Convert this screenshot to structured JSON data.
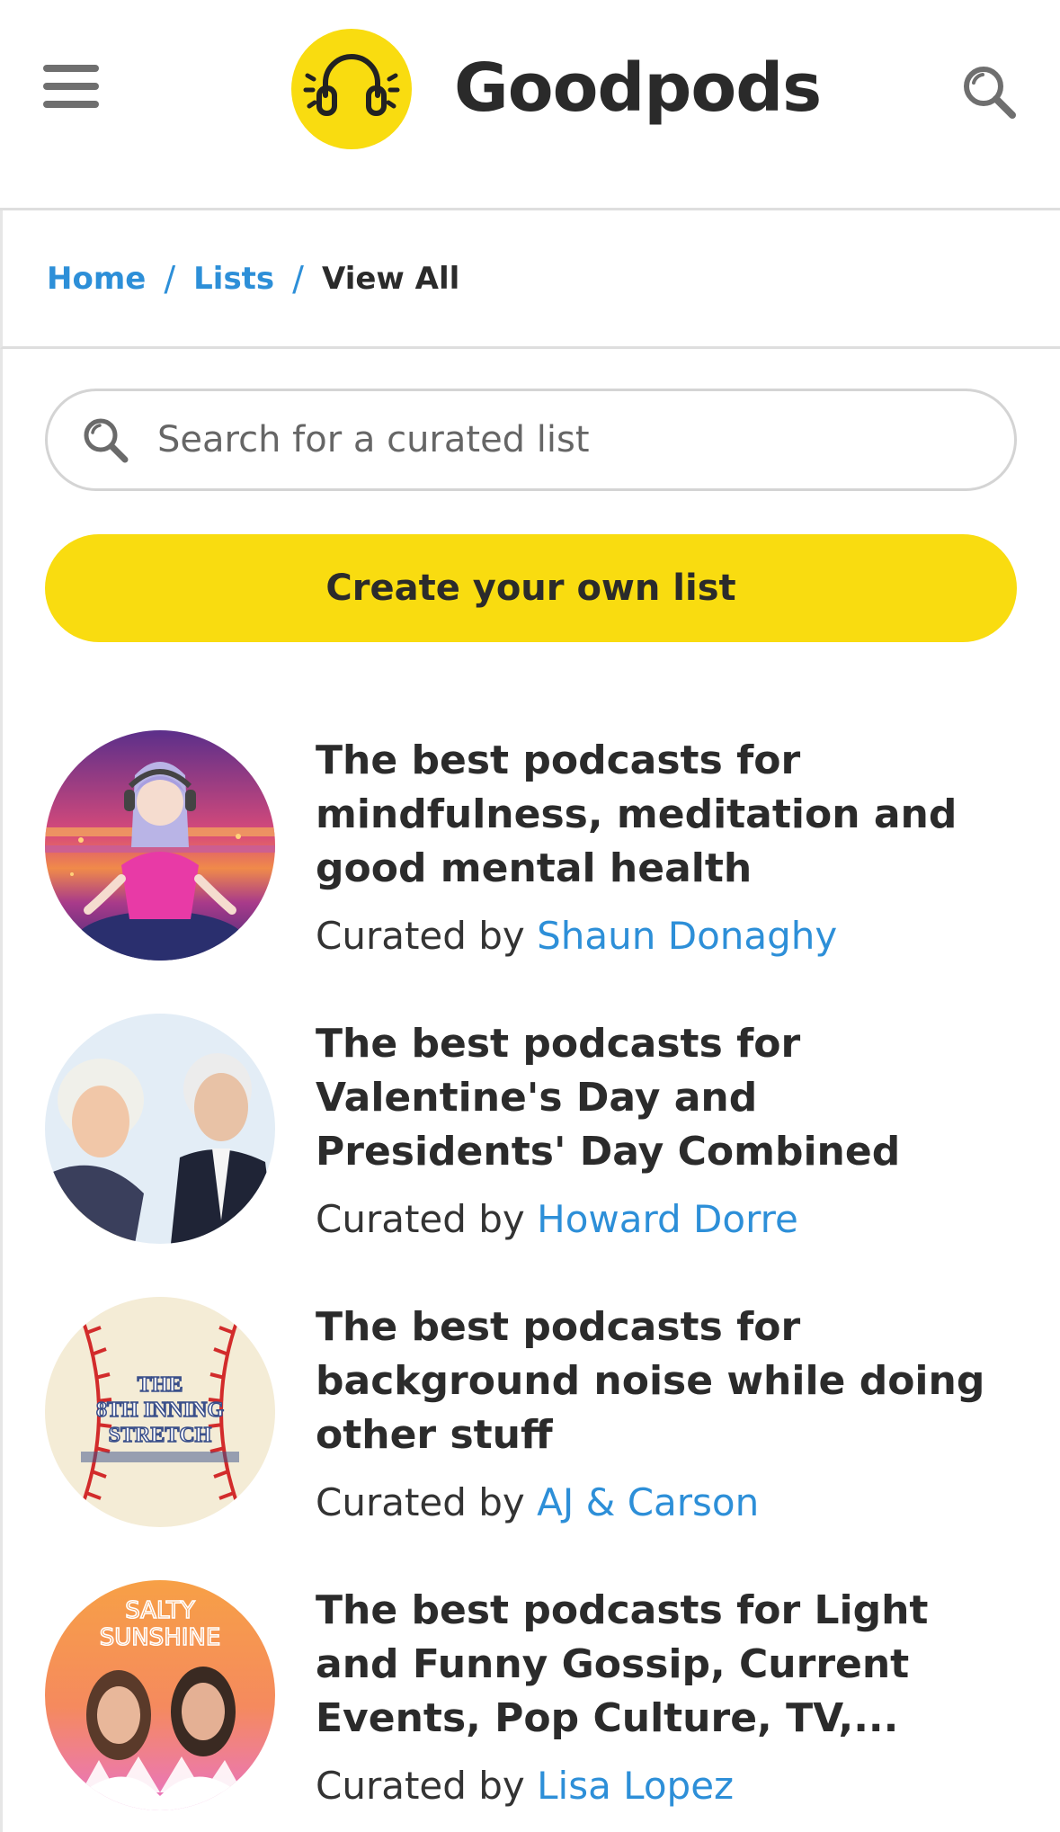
{
  "header": {
    "brand": "Goodpods",
    "menu_icon": "hamburger-menu-icon",
    "search_icon": "search-icon",
    "brand_color": "#f9dc10"
  },
  "breadcrumb": {
    "home": "Home",
    "lists": "Lists",
    "current": "View All",
    "separator": "/"
  },
  "search": {
    "placeholder": "Search for a curated list"
  },
  "create_button": {
    "label": "Create your own list"
  },
  "lists": [
    {
      "title": "The best podcasts for mindfulness, meditation and good mental health",
      "curated_prefix": "Curated by ",
      "curator": "Shaun Donaghy"
    },
    {
      "title": "The best podcasts for Valentine's Day and Presidents' Day Combined",
      "curated_prefix": "Curated by ",
      "curator": "Howard Dorre"
    },
    {
      "title": "The best podcasts for background noise while doing other stuff",
      "curated_prefix": "Curated by ",
      "curator": "AJ & Carson"
    },
    {
      "title": "The best podcasts for Light and Funny Gossip, Current Events, Pop Culture, TV,...",
      "curated_prefix": "Curated by ",
      "curator": "Lisa Lopez"
    }
  ],
  "thumb_text": {
    "third_line1": "THE",
    "third_line2": "8TH INNING",
    "third_line3": "STRETCH",
    "fourth_line1": "SALTY",
    "fourth_line2": "SUNSHINE"
  },
  "colors": {
    "link": "#2d8fd8",
    "accent": "#f9dc10"
  }
}
